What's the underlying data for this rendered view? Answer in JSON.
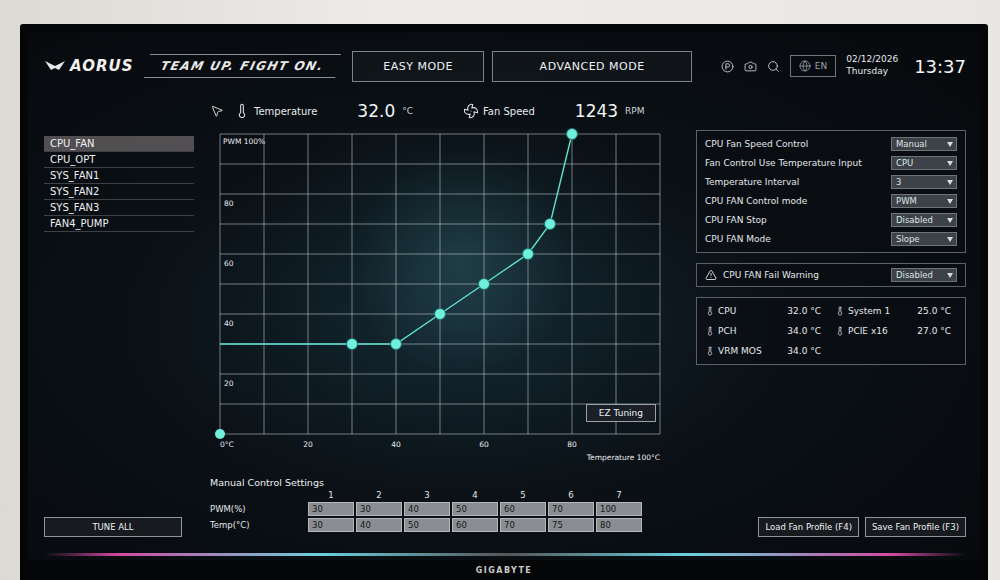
{
  "header": {
    "logo": "AORUS",
    "banner": "TEAM UP. FIGHT ON.",
    "tabs": [
      {
        "label": "EASY MODE",
        "selected": false
      },
      {
        "label": "ADVANCED MODE",
        "selected": false
      }
    ],
    "language": "EN",
    "date": "02/12/2026",
    "weekday": "Thursday",
    "time": "13:37"
  },
  "readout": {
    "temperature_label": "Temperature",
    "temperature": "32.0",
    "temperature_unit": "°C",
    "fan_label": "Fan Speed",
    "fan_speed": "1243",
    "fan_unit": "RPM"
  },
  "fans": [
    {
      "label": "CPU_FAN",
      "selected": true
    },
    {
      "label": "CPU_OPT",
      "selected": false
    },
    {
      "label": "SYS_FAN1",
      "selected": false
    },
    {
      "label": "SYS_FAN2",
      "selected": false
    },
    {
      "label": "SYS_FAN3",
      "selected": false
    },
    {
      "label": "FAN4_PUMP",
      "selected": false
    }
  ],
  "chart": {
    "y_label": "PWM 100%",
    "y_ticks": [
      "80",
      "60",
      "40",
      "20"
    ],
    "x_ticks": [
      "0°C",
      "20",
      "40",
      "60",
      "80"
    ],
    "x_label": "Temperature 100°C",
    "button": "EZ Tuning",
    "points": [
      {
        "temp": 30,
        "pwm": 30
      },
      {
        "temp": 40,
        "pwm": 30
      },
      {
        "temp": 50,
        "pwm": 40
      },
      {
        "temp": 60,
        "pwm": 50
      },
      {
        "temp": 70,
        "pwm": 60
      },
      {
        "temp": 75,
        "pwm": 70
      },
      {
        "temp": 80,
        "pwm": 100
      }
    ]
  },
  "manual": {
    "title": "Manual Control Settings",
    "columns": [
      "1",
      "2",
      "3",
      "4",
      "5",
      "6",
      "7"
    ],
    "rows": [
      {
        "label": "PWM(%)",
        "values": [
          "30",
          "30",
          "40",
          "50",
          "60",
          "70",
          "100"
        ]
      },
      {
        "label": "Temp(°C)",
        "values": [
          "30",
          "40",
          "50",
          "60",
          "70",
          "75",
          "80"
        ]
      }
    ]
  },
  "settings": [
    {
      "label": "CPU Fan Speed Control",
      "value": "Manual"
    },
    {
      "label": "Fan Control Use Temperature Input",
      "value": "CPU"
    },
    {
      "label": "Temperature Interval",
      "value": "3"
    },
    {
      "label": "CPU FAN Control mode",
      "value": "PWM"
    },
    {
      "label": "CPU FAN Stop",
      "value": "Disabled"
    },
    {
      "label": "CPU FAN Mode",
      "value": "Slope"
    }
  ],
  "warning": {
    "label": "CPU FAN Fail Warning",
    "value": "Disabled"
  },
  "sensors": [
    {
      "name": "CPU",
      "value": "32.0 °C"
    },
    {
      "name": "System 1",
      "value": "25.0 °C"
    },
    {
      "name": "PCH",
      "value": "34.0 °C"
    },
    {
      "name": "PCIE x16",
      "value": "27.0 °C"
    },
    {
      "name": "VRM MOS",
      "value": "34.0 °C"
    }
  ],
  "buttons": {
    "tune_all": "TUNE ALL",
    "load": "Load Fan Profile (F4)",
    "save": "Save Fan Profile (F3)"
  },
  "monitor": {
    "brand": "GIGABYTE"
  }
}
